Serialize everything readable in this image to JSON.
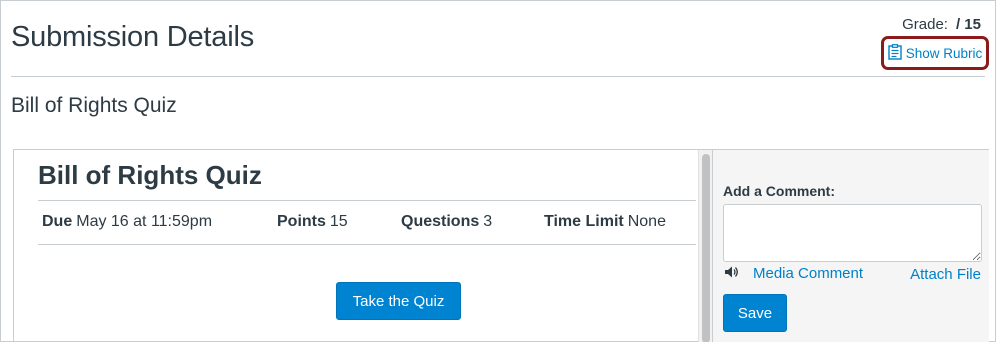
{
  "header": {
    "title": "Submission Details",
    "grade_label": "Grade:",
    "grade_value": "/ 15",
    "rubric_link": "Show Rubric",
    "rubric_icon": "clipboard-icon"
  },
  "assignment": {
    "name": "Bill of Rights Quiz"
  },
  "quiz": {
    "title": "Bill of Rights Quiz",
    "meta": [
      {
        "label": "Due",
        "value": "May 16 at 11:59pm"
      },
      {
        "label": "Points",
        "value": "15"
      },
      {
        "label": "Questions",
        "value": "3"
      },
      {
        "label": "Time Limit",
        "value": "None"
      }
    ],
    "take_button": "Take the Quiz"
  },
  "comments": {
    "label": "Add a Comment:",
    "input_value": "",
    "media_comment": "Media Comment",
    "media_icon": "speaker-icon",
    "attach_file": "Attach File",
    "save_button": "Save"
  },
  "colors": {
    "link": "#0081c7",
    "button": "#0084d1",
    "highlight": "#8b1a1a",
    "text": "#2d3b45"
  }
}
